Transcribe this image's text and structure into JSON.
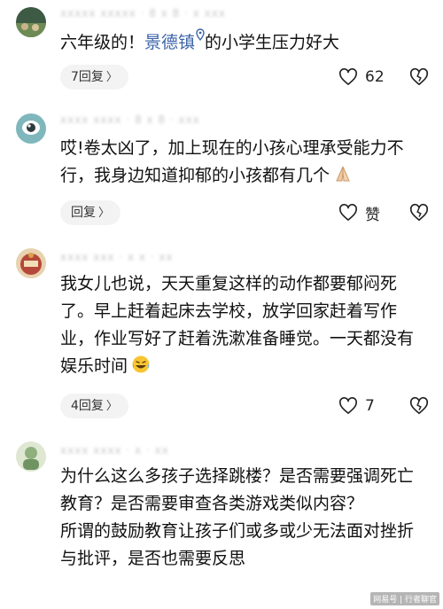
{
  "comments": [
    {
      "meta": "xxxxx xxxxx · 8 x 8 · x xxx",
      "text_before": "六年级的！",
      "location_link": "景德镇",
      "text_after": "的小学生压力好大",
      "reply_label": "7回复",
      "like_count": "62",
      "avatar_color": "#4b6b52"
    },
    {
      "meta": "xxxx xxxx · 8 x 8 · xxx",
      "text": "哎!卷太凶了，加上现在的小孩心理承受能力不行，我身边知道抑郁的小孩都有几个",
      "emoji": "folded-hands",
      "reply_label": "回复",
      "like_label": "赞",
      "avatar_color": "#7fb7bd"
    },
    {
      "meta": "xxxx xxx · x x · xx",
      "text": "我女儿也说，天天重复这样的动作都要郁闷死了。早上赶着起床去学校，放学回家赶着写作业，作业写好了赶着洗漱准备睡觉。一天都没有娱乐时间",
      "emoji": "laughing-crying-face",
      "reply_label": "4回复",
      "like_count": "7",
      "avatar_color": "#b5483a"
    },
    {
      "meta": "xxxx xxxx · x · xx",
      "paragraph1": "为什么这么多孩子选择跳楼？是否需要强调死亡教育？是否需要审查各类游戏类似内容？",
      "paragraph2": "所谓的鼓励教育让孩子们或多或少无法面对挫折与批评，是否也需要反思",
      "avatar_color": "#8fb07d"
    }
  ],
  "watermark": "网易号 | 行者聊官"
}
